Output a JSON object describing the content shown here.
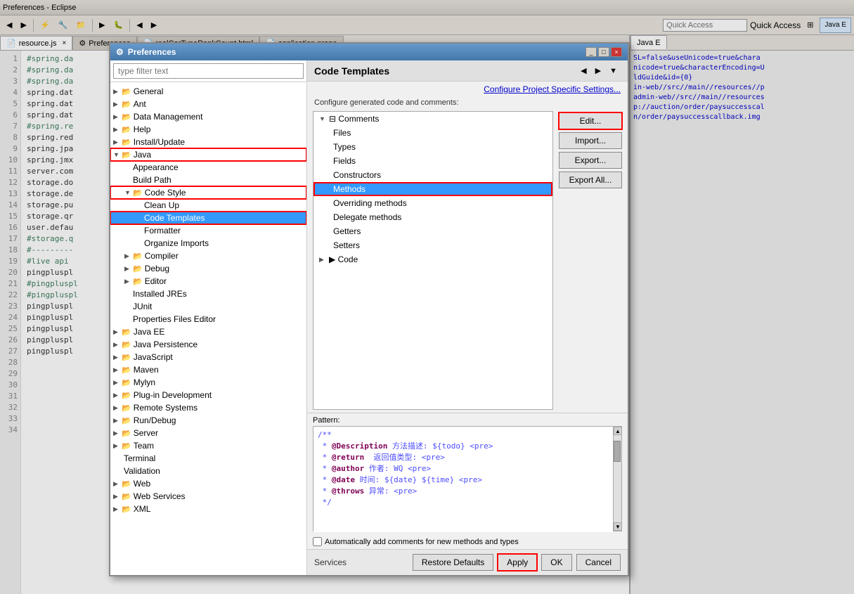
{
  "app": {
    "title": "Preferences - Eclipse",
    "toolbar": {
      "quick_access_label": "Quick Access",
      "quick_access_placeholder": "Quick Access"
    }
  },
  "editor": {
    "tabs": [
      "resource.js",
      "Preferences",
      "realCarTypeRankCount.html",
      "application.prope"
    ],
    "active_tab": "resource.js",
    "lines": [
      {
        "num": "1",
        "text": "#spring.da"
      },
      {
        "num": "2",
        "text": "#spring.da"
      },
      {
        "num": "3",
        "text": "#spring.da"
      },
      {
        "num": "4",
        "text": "spring.dat"
      },
      {
        "num": "5",
        "text": "spring.dat"
      },
      {
        "num": "6",
        "text": "spring.dat"
      },
      {
        "num": "7",
        "text": ""
      },
      {
        "num": "8",
        "text": "#spring.re"
      },
      {
        "num": "9",
        "text": "spring.red"
      },
      {
        "num": "10",
        "text": ""
      },
      {
        "num": "11",
        "text": "spring.jpa"
      },
      {
        "num": "12",
        "text": ""
      },
      {
        "num": "13",
        "text": ""
      },
      {
        "num": "14",
        "text": "spring.jmx"
      },
      {
        "num": "15",
        "text": "server.com"
      },
      {
        "num": "16",
        "text": ""
      },
      {
        "num": "17",
        "text": "storage.do"
      },
      {
        "num": "18",
        "text": "storage.de"
      },
      {
        "num": "19",
        "text": "storage.pu"
      },
      {
        "num": "20",
        "text": "storage.qr"
      },
      {
        "num": "21",
        "text": "user.defau"
      },
      {
        "num": "22",
        "text": "#storage.q"
      },
      {
        "num": "23",
        "text": ""
      },
      {
        "num": "24",
        "text": "#---------"
      },
      {
        "num": "25",
        "text": ""
      },
      {
        "num": "26",
        "text": "#live  api"
      },
      {
        "num": "27",
        "text": "pingpluspl"
      },
      {
        "num": "28",
        "text": "#pingpluspl"
      },
      {
        "num": "29",
        "text": "#pingpluspl"
      },
      {
        "num": "30",
        "text": "pingpluspl"
      },
      {
        "num": "31",
        "text": "pingpluspl"
      },
      {
        "num": "32",
        "text": "pingpluspl"
      },
      {
        "num": "33",
        "text": "pingpluspl"
      },
      {
        "num": "34",
        "text": "pingpluspl"
      }
    ]
  },
  "right_panel": {
    "tab": "Java E",
    "lines": [
      "SL=false&useUnicode=true&chara",
      "",
      "nicode=true&characterEncoding=U",
      "",
      "",
      "",
      "",
      "ldGuide&id={0}",
      "",
      "",
      "",
      "",
      "",
      "in-web//src//main//resources//p",
      "admin-web//src//main//resources",
      "",
      "",
      "",
      "p://auction/order/paysuccesscal",
      "n/order/paysuccesscallback.img"
    ]
  },
  "preferences": {
    "title": "Preferences",
    "filter_placeholder": "type filter text",
    "tree": {
      "items": [
        {
          "id": "general",
          "label": "General",
          "level": 1,
          "expand": true
        },
        {
          "id": "ant",
          "label": "Ant",
          "level": 1,
          "expand": true
        },
        {
          "id": "data-management",
          "label": "Data Management",
          "level": 1,
          "expand": true
        },
        {
          "id": "help",
          "label": "Help",
          "level": 1,
          "expand": true
        },
        {
          "id": "install-update",
          "label": "Install/Update",
          "level": 1,
          "expand": true
        },
        {
          "id": "java",
          "label": "Java",
          "level": 1,
          "expand": true,
          "expanded": true,
          "highlighted": true
        },
        {
          "id": "appearance",
          "label": "Appearance",
          "level": 2,
          "expand": false
        },
        {
          "id": "build-path",
          "label": "Build Path",
          "level": 2,
          "expand": false
        },
        {
          "id": "code-style",
          "label": "Code Style",
          "level": 2,
          "expand": true,
          "expanded": true,
          "highlighted": true
        },
        {
          "id": "clean-up",
          "label": "Clean Up",
          "level": 3,
          "expand": false
        },
        {
          "id": "code-templates",
          "label": "Code Templates",
          "level": 3,
          "expand": false,
          "selected": true,
          "highlighted": true
        },
        {
          "id": "formatter",
          "label": "Formatter",
          "level": 3,
          "expand": false
        },
        {
          "id": "organize-imports",
          "label": "Organize Imports",
          "level": 3,
          "expand": false
        },
        {
          "id": "compiler",
          "label": "Compiler",
          "level": 2,
          "expand": true
        },
        {
          "id": "debug",
          "label": "Debug",
          "level": 2,
          "expand": true
        },
        {
          "id": "editor",
          "label": "Editor",
          "level": 2,
          "expand": true
        },
        {
          "id": "installed-jres",
          "label": "Installed JREs",
          "level": 2,
          "expand": false
        },
        {
          "id": "junit",
          "label": "JUnit",
          "level": 2,
          "expand": false
        },
        {
          "id": "properties-files-editor",
          "label": "Properties Files Editor",
          "level": 2,
          "expand": false
        },
        {
          "id": "java-ee",
          "label": "Java EE",
          "level": 1,
          "expand": true
        },
        {
          "id": "java-persistence",
          "label": "Java Persistence",
          "level": 1,
          "expand": true
        },
        {
          "id": "javascript",
          "label": "JavaScript",
          "level": 1,
          "expand": true
        },
        {
          "id": "maven",
          "label": "Maven",
          "level": 1,
          "expand": true
        },
        {
          "id": "mylyn",
          "label": "Mylyn",
          "level": 1,
          "expand": true
        },
        {
          "id": "plugin-development",
          "label": "Plug-in Development",
          "level": 1,
          "expand": true
        },
        {
          "id": "remote-systems",
          "label": "Remote Systems",
          "level": 1,
          "expand": true
        },
        {
          "id": "run-debug",
          "label": "Run/Debug",
          "level": 1,
          "expand": true
        },
        {
          "id": "server",
          "label": "Server",
          "level": 1,
          "expand": true
        },
        {
          "id": "team",
          "label": "Team",
          "level": 1,
          "expand": true
        },
        {
          "id": "terminal",
          "label": "Terminal",
          "level": 1,
          "expand": false
        },
        {
          "id": "validation",
          "label": "Validation",
          "level": 1,
          "expand": false
        },
        {
          "id": "web",
          "label": "Web",
          "level": 1,
          "expand": true
        },
        {
          "id": "web-services",
          "label": "Web Services",
          "level": 1,
          "expand": true
        },
        {
          "id": "xml",
          "label": "XML",
          "level": 1,
          "expand": true
        }
      ]
    },
    "content": {
      "title": "Code Templates",
      "configure_link": "Configure Project Specific Settings...",
      "configure_text": "Configure generated code and comments:",
      "templates": {
        "comments": {
          "label": "Comments",
          "expanded": true,
          "children": [
            {
              "id": "files",
              "label": "Files"
            },
            {
              "id": "types",
              "label": "Types"
            },
            {
              "id": "fields",
              "label": "Fields"
            },
            {
              "id": "constructors",
              "label": "Constructors"
            },
            {
              "id": "methods",
              "label": "Methods",
              "selected": true,
              "highlighted": true
            },
            {
              "id": "overriding-methods",
              "label": "Overriding methods"
            },
            {
              "id": "delegate-methods",
              "label": "Delegate methods"
            },
            {
              "id": "getters",
              "label": "Getters"
            },
            {
              "id": "setters",
              "label": "Setters"
            }
          ]
        },
        "code": {
          "label": "Code",
          "expanded": false
        }
      },
      "action_buttons": [
        "Edit...",
        "Import...",
        "Export...",
        "Export All..."
      ],
      "pattern_label": "Pattern:",
      "pattern_content": [
        "/**",
        " * @Description 方法描述: ${todo} <pre>",
        " * @return  返回值类型: <pre>",
        " * @author 作者: WQ <pre>",
        " * @date 时间: ${date} ${time} <pre>",
        " * @throws 异常: <pre>",
        " */"
      ],
      "checkbox_label": "Automatically add comments for new methods and types",
      "buttons": {
        "restore_defaults": "Restore Defaults",
        "apply": "Apply"
      }
    },
    "footer": {
      "services_label": "Services",
      "ok_label": "OK",
      "cancel_label": "Cancel"
    }
  }
}
